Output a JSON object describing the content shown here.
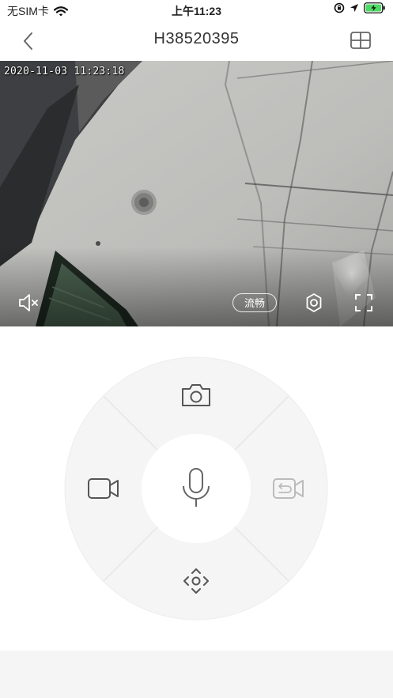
{
  "status": {
    "carrier": "无SIM卡",
    "time": "上午11:23"
  },
  "nav": {
    "title": "H38520395"
  },
  "video": {
    "timestamp": "2020-11-03 11:23:18",
    "quality_label": "流畅"
  },
  "icons": {
    "back": "chevron-left-icon",
    "layout": "grid-layout-icon",
    "mute": "speaker-muted-icon",
    "settings": "gear-icon",
    "fullscreen": "fullscreen-icon",
    "snapshot": "camera-icon",
    "record": "video-record-icon",
    "mic": "microphone-icon",
    "playback": "video-playback-icon",
    "ptz": "ptz-direction-icon"
  },
  "colors": {
    "icon": "#555555",
    "icon_disabled": "#bbbbbb",
    "pad_outer": "#f5f5f5",
    "battery": "#4cd964"
  }
}
